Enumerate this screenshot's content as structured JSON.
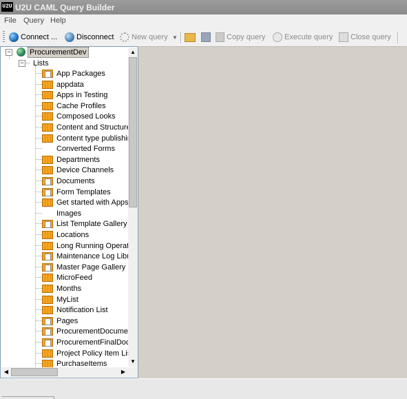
{
  "window": {
    "title": "U2U CAML Query Builder",
    "app_icon_text": "U2U"
  },
  "menu": [
    "File",
    "Query",
    "Help"
  ],
  "toolbar": {
    "connect": "Connect ...",
    "disconnect": "Disconnect",
    "new_query": "New query",
    "copy_query": "Copy query",
    "execute_query": "Execute query",
    "close_query": "Close query"
  },
  "tree": {
    "root": "ProcurementDev",
    "lists_label": "Lists",
    "items": [
      {
        "label": "App Packages",
        "icon": "list-doc-icon"
      },
      {
        "label": "appdata",
        "icon": "list-icon"
      },
      {
        "label": "Apps in Testing",
        "icon": "list-icon"
      },
      {
        "label": "Cache Profiles",
        "icon": "list-icon"
      },
      {
        "label": "Composed Looks",
        "icon": "list-icon"
      },
      {
        "label": "Content and Structure",
        "icon": "list-icon"
      },
      {
        "label": "Content type publishing",
        "icon": "list-icon"
      },
      {
        "label": "Converted Forms",
        "icon": "none"
      },
      {
        "label": "Departments",
        "icon": "list-icon"
      },
      {
        "label": "Device Channels",
        "icon": "list-icon"
      },
      {
        "label": "Documents",
        "icon": "list-doc-icon"
      },
      {
        "label": "Form Templates",
        "icon": "list-doc-icon"
      },
      {
        "label": "Get started with Apps f",
        "icon": "list-icon"
      },
      {
        "label": "Images",
        "icon": "none"
      },
      {
        "label": "List Template Gallery",
        "icon": "list-doc-icon"
      },
      {
        "label": "Locations",
        "icon": "list-icon"
      },
      {
        "label": "Long Running Operatio",
        "icon": "list-icon"
      },
      {
        "label": "Maintenance Log Libra",
        "icon": "list-doc-icon"
      },
      {
        "label": "Master Page Gallery",
        "icon": "list-doc-icon"
      },
      {
        "label": "MicroFeed",
        "icon": "list-icon"
      },
      {
        "label": "Months",
        "icon": "list-icon"
      },
      {
        "label": "MyList",
        "icon": "list-icon"
      },
      {
        "label": "Notification List",
        "icon": "list-icon"
      },
      {
        "label": "Pages",
        "icon": "list-doc-icon"
      },
      {
        "label": "ProcurementDocumen",
        "icon": "list-doc-icon"
      },
      {
        "label": "ProcurementFinalDocu",
        "icon": "list-doc-icon"
      },
      {
        "label": "Project Policy Item List",
        "icon": "list-icon"
      },
      {
        "label": "PurchaseItems",
        "icon": "list-icon"
      }
    ]
  }
}
